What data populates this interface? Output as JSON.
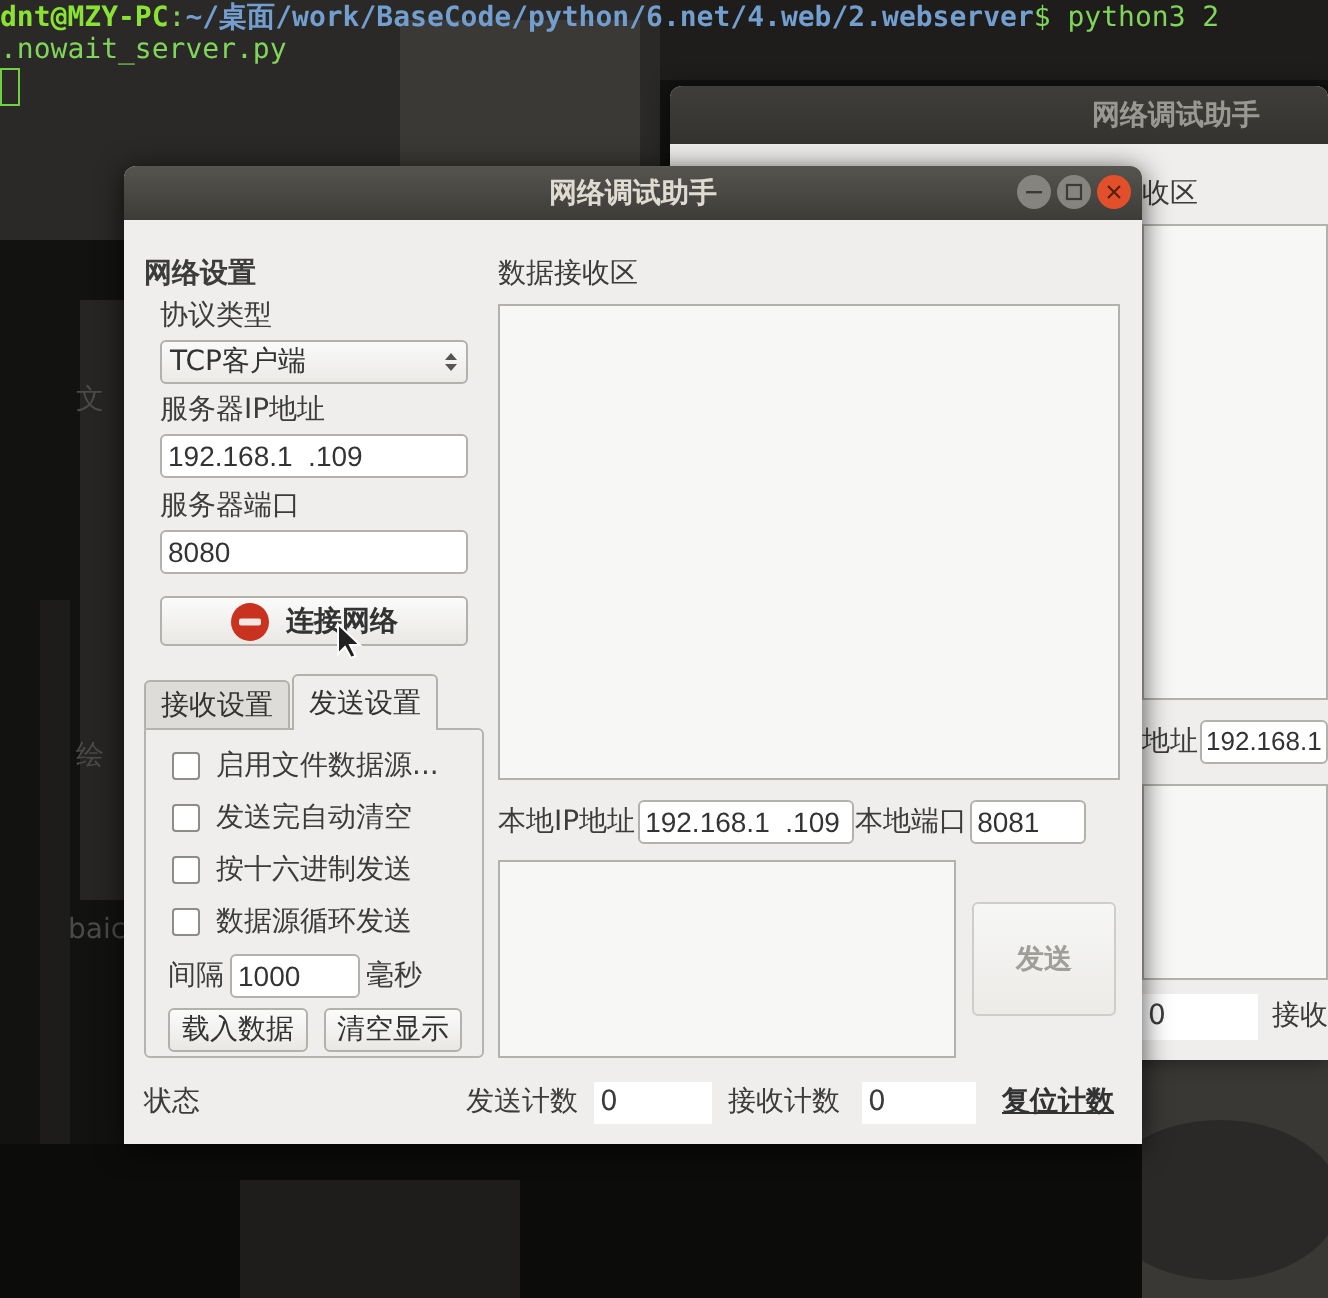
{
  "terminal": {
    "lines": [
      [
        {
          "kind": "user",
          "text": "dnt@MZY-PC"
        },
        {
          "kind": "plain",
          "text": ":"
        },
        {
          "kind": "path",
          "text": "~/桌面/work/BaseCode/python/6.net/4.web/2.webserver"
        },
        {
          "kind": "plain",
          "text": "$ python3 2"
        }
      ],
      [
        {
          "kind": "plain",
          "text": ".nowait_server.py"
        }
      ]
    ]
  },
  "desktop_icons": [
    {
      "label": "文"
    },
    {
      "label": "绘"
    },
    {
      "label": "baic"
    }
  ],
  "back_window": {
    "title": "网络调试助手",
    "receive_label": "收区",
    "local_ip_label": "地址",
    "local_ip": "192.168.1",
    "send_count": "0",
    "receive_count_label": "接收"
  },
  "window": {
    "title": "网络调试助手",
    "heading": "网络设置",
    "protocol_label": "协议类型",
    "protocol": "TCP客户端",
    "server_ip_label": "服务器IP地址",
    "server_ip": "192.168.1  .109",
    "server_port_label": "服务器端口",
    "server_port": "8080",
    "connect_button": "连接网络",
    "tabs": [
      {
        "label": "接收设置",
        "selected": false
      },
      {
        "label": "发送设置",
        "selected": true
      }
    ],
    "send_options": [
      {
        "label": "启用文件数据源...",
        "checked": false
      },
      {
        "label": "发送完自动清空",
        "checked": false
      },
      {
        "label": "按十六进制发送",
        "checked": false
      },
      {
        "label": "数据源循环发送",
        "checked": false
      }
    ],
    "interval_label": "间隔",
    "interval": "1000",
    "interval_unit": "毫秒",
    "buttons": [
      "载入数据",
      "清空显示"
    ],
    "receive_label": "数据接收区",
    "local_ip_label": "本地IP地址",
    "local_ip": "192.168.1  .109",
    "local_port_label": "本地端口",
    "local_port": "8081",
    "send_button": {
      "label": "发送",
      "disabled": true
    },
    "status": "状态",
    "send_count_label": "发送计数",
    "send_count": "0",
    "receive_count_label": "接收计数",
    "receive_count": "0",
    "reset_label": "复位计数"
  }
}
